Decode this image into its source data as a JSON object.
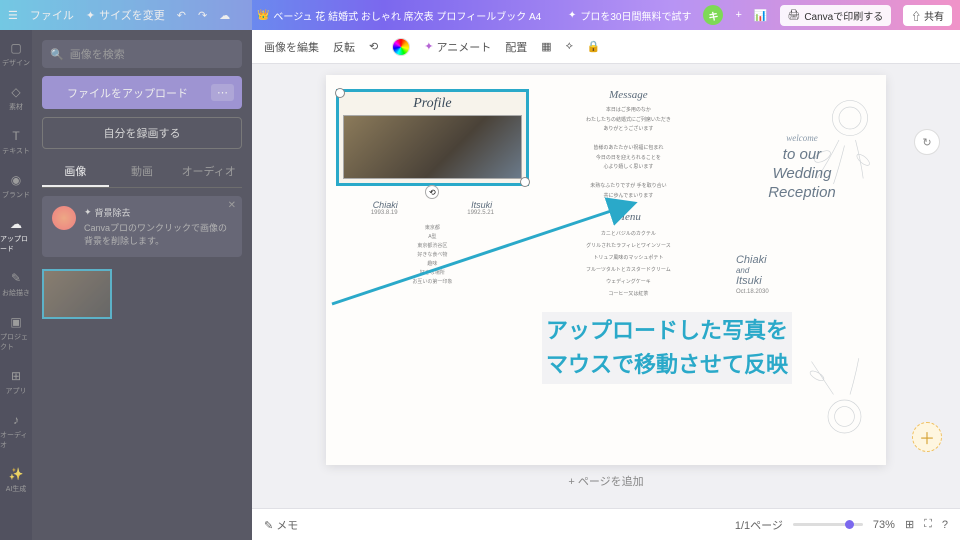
{
  "topbar": {
    "file": "ファイル",
    "resize": "サイズを変更",
    "doc_title": "ベージュ 花 結婚式 おしゃれ 席次表 プロフィールブック A4",
    "try_pro": "プロを30日間無料で試す",
    "avatar_initial": "キ",
    "print": "Canvaで印刷する",
    "share": "共有"
  },
  "rail": {
    "items": [
      "デザイン",
      "素材",
      "テキスト",
      "ブランド",
      "アップロード",
      "お絵描き",
      "プロジェクト",
      "アプリ",
      "オーディオ",
      "AI生成"
    ]
  },
  "sidebar": {
    "search_placeholder": "画像を検索",
    "upload": "ファイルをアップロード",
    "record": "自分を録画する",
    "tabs": [
      "画像",
      "動画",
      "オーディオ"
    ],
    "bgremove_title": "背景除去",
    "bgremove_desc": "Canvaプロのワンクリックで画像の背景を削除します。"
  },
  "ctx": {
    "edit": "画像を編集",
    "flip": "反転",
    "animate": "アニメート",
    "position": "配置"
  },
  "annotation": {
    "line1": "アップロードした写真を",
    "line2": "マウスで移動させて反映"
  },
  "page": {
    "profile": {
      "title": "Profile",
      "name_left": "Chiaki",
      "name_right": "Itsuki",
      "date_left": "1993.8.19",
      "date_right": "1992.5.21",
      "rows": [
        "東京都",
        "A型",
        "東京都渋谷区",
        "好きな食べ物",
        "趣味",
        "好きな場所",
        "お互いの第一印象"
      ]
    },
    "message": {
      "title": "Message",
      "lines": [
        "本日はご多用のなか",
        "わたしたちの結婚式にご列席いただき",
        "ありがとうございます",
        "",
        "皆様のあたたかい祝福に包まれ",
        "今日の日を迎えられることを",
        "心より嬉しく思います",
        "",
        "未熟なふたりですが 手を取り合い",
        "共に歩んでまいります"
      ]
    },
    "menu": {
      "title": "Menu",
      "items": [
        "カニとバジルのカクテル",
        "グリルされたラフィレとワインソース",
        "トリュフ風味のマッシュポテト",
        "フルーツタルトとカスタードクリーム",
        "ウェディングケーキ",
        "コーヒー又は紅茶"
      ]
    },
    "right": {
      "welcome": "welcome",
      "wedding1": "to our",
      "wedding2": "Wedding",
      "wedding3": "Reception",
      "name1": "Chiaki",
      "and": "and",
      "name2": "Itsuki",
      "date": "Oct.18.2030"
    }
  },
  "add_page": "+ ページを追加",
  "bottom": {
    "notes": "メモ",
    "page_count": "1/1ページ",
    "zoom": "73%"
  }
}
